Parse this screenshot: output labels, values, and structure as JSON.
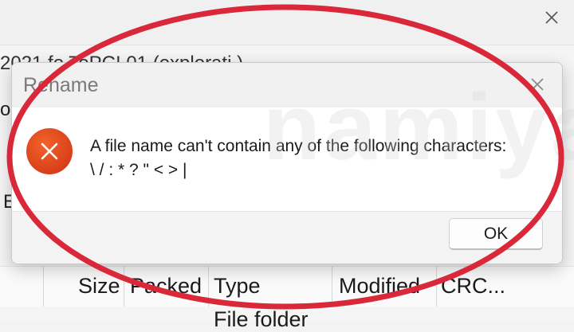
{
  "background_window": {
    "path_text": "2021 fo      ToPC!       01        (explorati       )",
    "side_letter_top": "o",
    "side_letter_bottom": "E",
    "columns": [
      "Size",
      "Packed",
      "Type",
      "Modified",
      "CRC..."
    ],
    "row_type": "File folder"
  },
  "dialog": {
    "title": "Rename",
    "close_icon": "close-icon",
    "icon": "error-icon",
    "message_line1": "A file name can't contain any of the following characters:",
    "message_line2": "\\ / :  * ? \" < > |",
    "ok_label": "OK"
  },
  "watermark": "namiya",
  "colors": {
    "error_red": "#d8401a",
    "annotation_red": "#d8283a"
  }
}
